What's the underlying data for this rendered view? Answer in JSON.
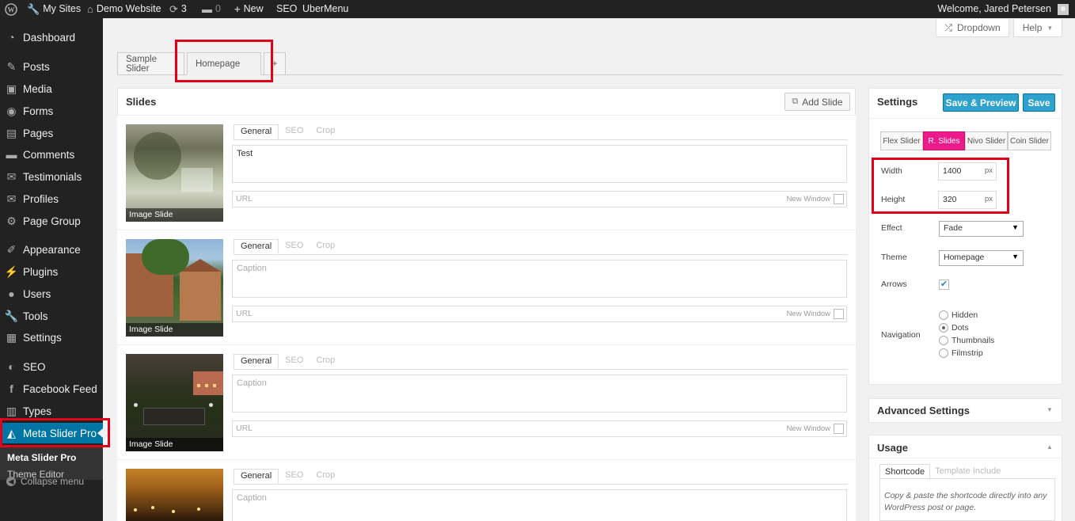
{
  "adminbar": {
    "my_sites": "My Sites",
    "site_name": "Demo Website",
    "updates": "3",
    "comments": "0",
    "new": "New",
    "seo": "SEO",
    "ubermenu": "UberMenu",
    "welcome": "Welcome, Jared Petersen"
  },
  "sidebar": {
    "items": [
      {
        "label": "Dashboard",
        "icon": "dashboard-icon"
      },
      {
        "label": "Posts",
        "icon": "pushpin-icon"
      },
      {
        "label": "Media",
        "icon": "media-icon"
      },
      {
        "label": "Forms",
        "icon": "forms-icon"
      },
      {
        "label": "Pages",
        "icon": "pages-icon"
      },
      {
        "label": "Comments",
        "icon": "comments-icon"
      },
      {
        "label": "Testimonials",
        "icon": "testimonials-icon"
      },
      {
        "label": "Profiles",
        "icon": "profiles-icon"
      },
      {
        "label": "Page Group",
        "icon": "page-group-icon"
      },
      {
        "label": "Appearance",
        "icon": "appearance-icon"
      },
      {
        "label": "Plugins",
        "icon": "plugins-icon"
      },
      {
        "label": "Users",
        "icon": "users-icon"
      },
      {
        "label": "Tools",
        "icon": "tools-icon"
      },
      {
        "label": "Settings",
        "icon": "settings-icon"
      },
      {
        "label": "SEO",
        "icon": "seo-icon"
      },
      {
        "label": "Facebook Feed",
        "icon": "facebook-icon"
      },
      {
        "label": "Types",
        "icon": "types-icon"
      },
      {
        "label": "Meta Slider Pro",
        "icon": "meta-slider-icon"
      }
    ],
    "submenu": [
      "Meta Slider Pro",
      "Theme Editor"
    ],
    "collapse": "Collapse menu"
  },
  "screen_options": {
    "dropdown": "Dropdown",
    "help": "Help"
  },
  "slider_tabs": [
    "Sample Slider",
    "Homepage",
    "+"
  ],
  "slides_panel": {
    "title": "Slides",
    "add_slide": "Add Slide",
    "tabs": [
      "General",
      "SEO",
      "Crop"
    ],
    "url_placeholder": "URL",
    "new_window": "New Window",
    "slides": [
      {
        "type": "Image Slide",
        "caption": "Test"
      },
      {
        "type": "Image Slide",
        "caption": "Caption"
      },
      {
        "type": "Image Slide",
        "caption": "Caption"
      },
      {
        "type": "",
        "caption": "Caption"
      }
    ]
  },
  "settings": {
    "title": "Settings",
    "save_preview": "Save & Preview",
    "save": "Save",
    "slider_types": [
      "Flex Slider",
      "R. Slides",
      "Nivo Slider",
      "Coin Slider"
    ],
    "active_type": "R. Slides",
    "width_label": "Width",
    "width": "1400",
    "height_label": "Height",
    "height": "320",
    "unit": "px",
    "effect_label": "Effect",
    "effect": "Fade",
    "theme_label": "Theme",
    "theme": "Homepage",
    "arrows_label": "Arrows",
    "arrows_checked": true,
    "navigation_label": "Navigation",
    "navigation_options": [
      "Hidden",
      "Dots",
      "Thumbnails",
      "Filmstrip"
    ],
    "navigation_selected": "Dots",
    "accent": "#2ea2cc",
    "active_type_color": "#ec1a8a"
  },
  "advanced": {
    "title": "Advanced Settings"
  },
  "usage": {
    "title": "Usage",
    "tabs": [
      "Shortcode",
      "Template Include"
    ],
    "text": "Copy & paste the shortcode directly into any WordPress post or page."
  },
  "highlight_color": "#e0001b"
}
